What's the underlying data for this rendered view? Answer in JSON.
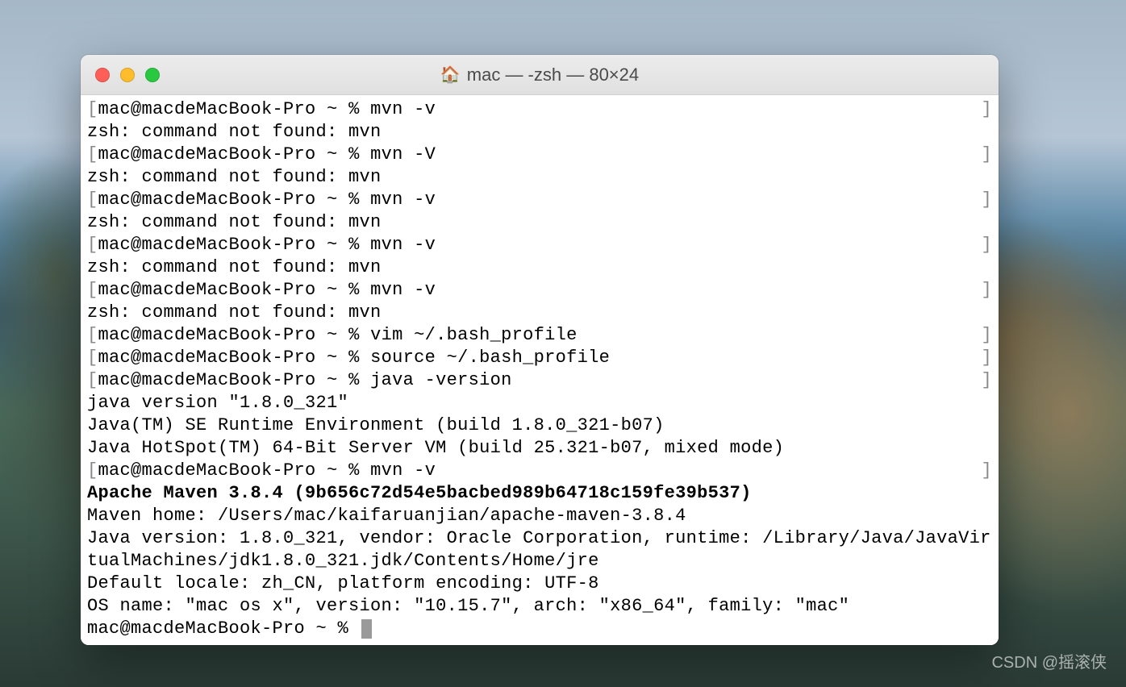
{
  "window": {
    "title": "mac — -zsh — 80×24",
    "icon": "🏠"
  },
  "terminal": {
    "lines": [
      {
        "text": "mac@macdeMacBook-Pro ~ % mvn -v",
        "bracket": true
      },
      {
        "text": "zsh: command not found: mvn"
      },
      {
        "text": "mac@macdeMacBook-Pro ~ % mvn -V",
        "bracket": true
      },
      {
        "text": "zsh: command not found: mvn"
      },
      {
        "text": "mac@macdeMacBook-Pro ~ % mvn -v",
        "bracket": true
      },
      {
        "text": "zsh: command not found: mvn"
      },
      {
        "text": "mac@macdeMacBook-Pro ~ % mvn -v",
        "bracket": true
      },
      {
        "text": "zsh: command not found: mvn"
      },
      {
        "text": "mac@macdeMacBook-Pro ~ % mvn -v",
        "bracket": true
      },
      {
        "text": "zsh: command not found: mvn"
      },
      {
        "text": "mac@macdeMacBook-Pro ~ % vim ~/.bash_profile",
        "bracket": true
      },
      {
        "text": "mac@macdeMacBook-Pro ~ % source ~/.bash_profile",
        "bracket": true
      },
      {
        "text": "mac@macdeMacBook-Pro ~ % java -version",
        "bracket": true
      },
      {
        "text": "java version \"1.8.0_321\""
      },
      {
        "text": "Java(TM) SE Runtime Environment (build 1.8.0_321-b07)"
      },
      {
        "text": "Java HotSpot(TM) 64-Bit Server VM (build 25.321-b07, mixed mode)"
      },
      {
        "text": "mac@macdeMacBook-Pro ~ % mvn -v",
        "bracket": true
      },
      {
        "text": "Apache Maven 3.8.4 (9b656c72d54e5bacbed989b64718c159fe39b537)",
        "bold": true
      },
      {
        "text": "Maven home: /Users/mac/kaifaruanjian/apache-maven-3.8.4"
      },
      {
        "text": "Java version: 1.8.0_321, vendor: Oracle Corporation, runtime: /Library/Java/JavaVirtualMachines/jdk1.8.0_321.jdk/Contents/Home/jre"
      },
      {
        "text": "Default locale: zh_CN, platform encoding: UTF-8"
      },
      {
        "text": "OS name: \"mac os x\", version: \"10.15.7\", arch: \"x86_64\", family: \"mac\""
      },
      {
        "text": "mac@macdeMacBook-Pro ~ % ",
        "cursor": true
      }
    ]
  },
  "watermark": "CSDN @摇滚侠"
}
